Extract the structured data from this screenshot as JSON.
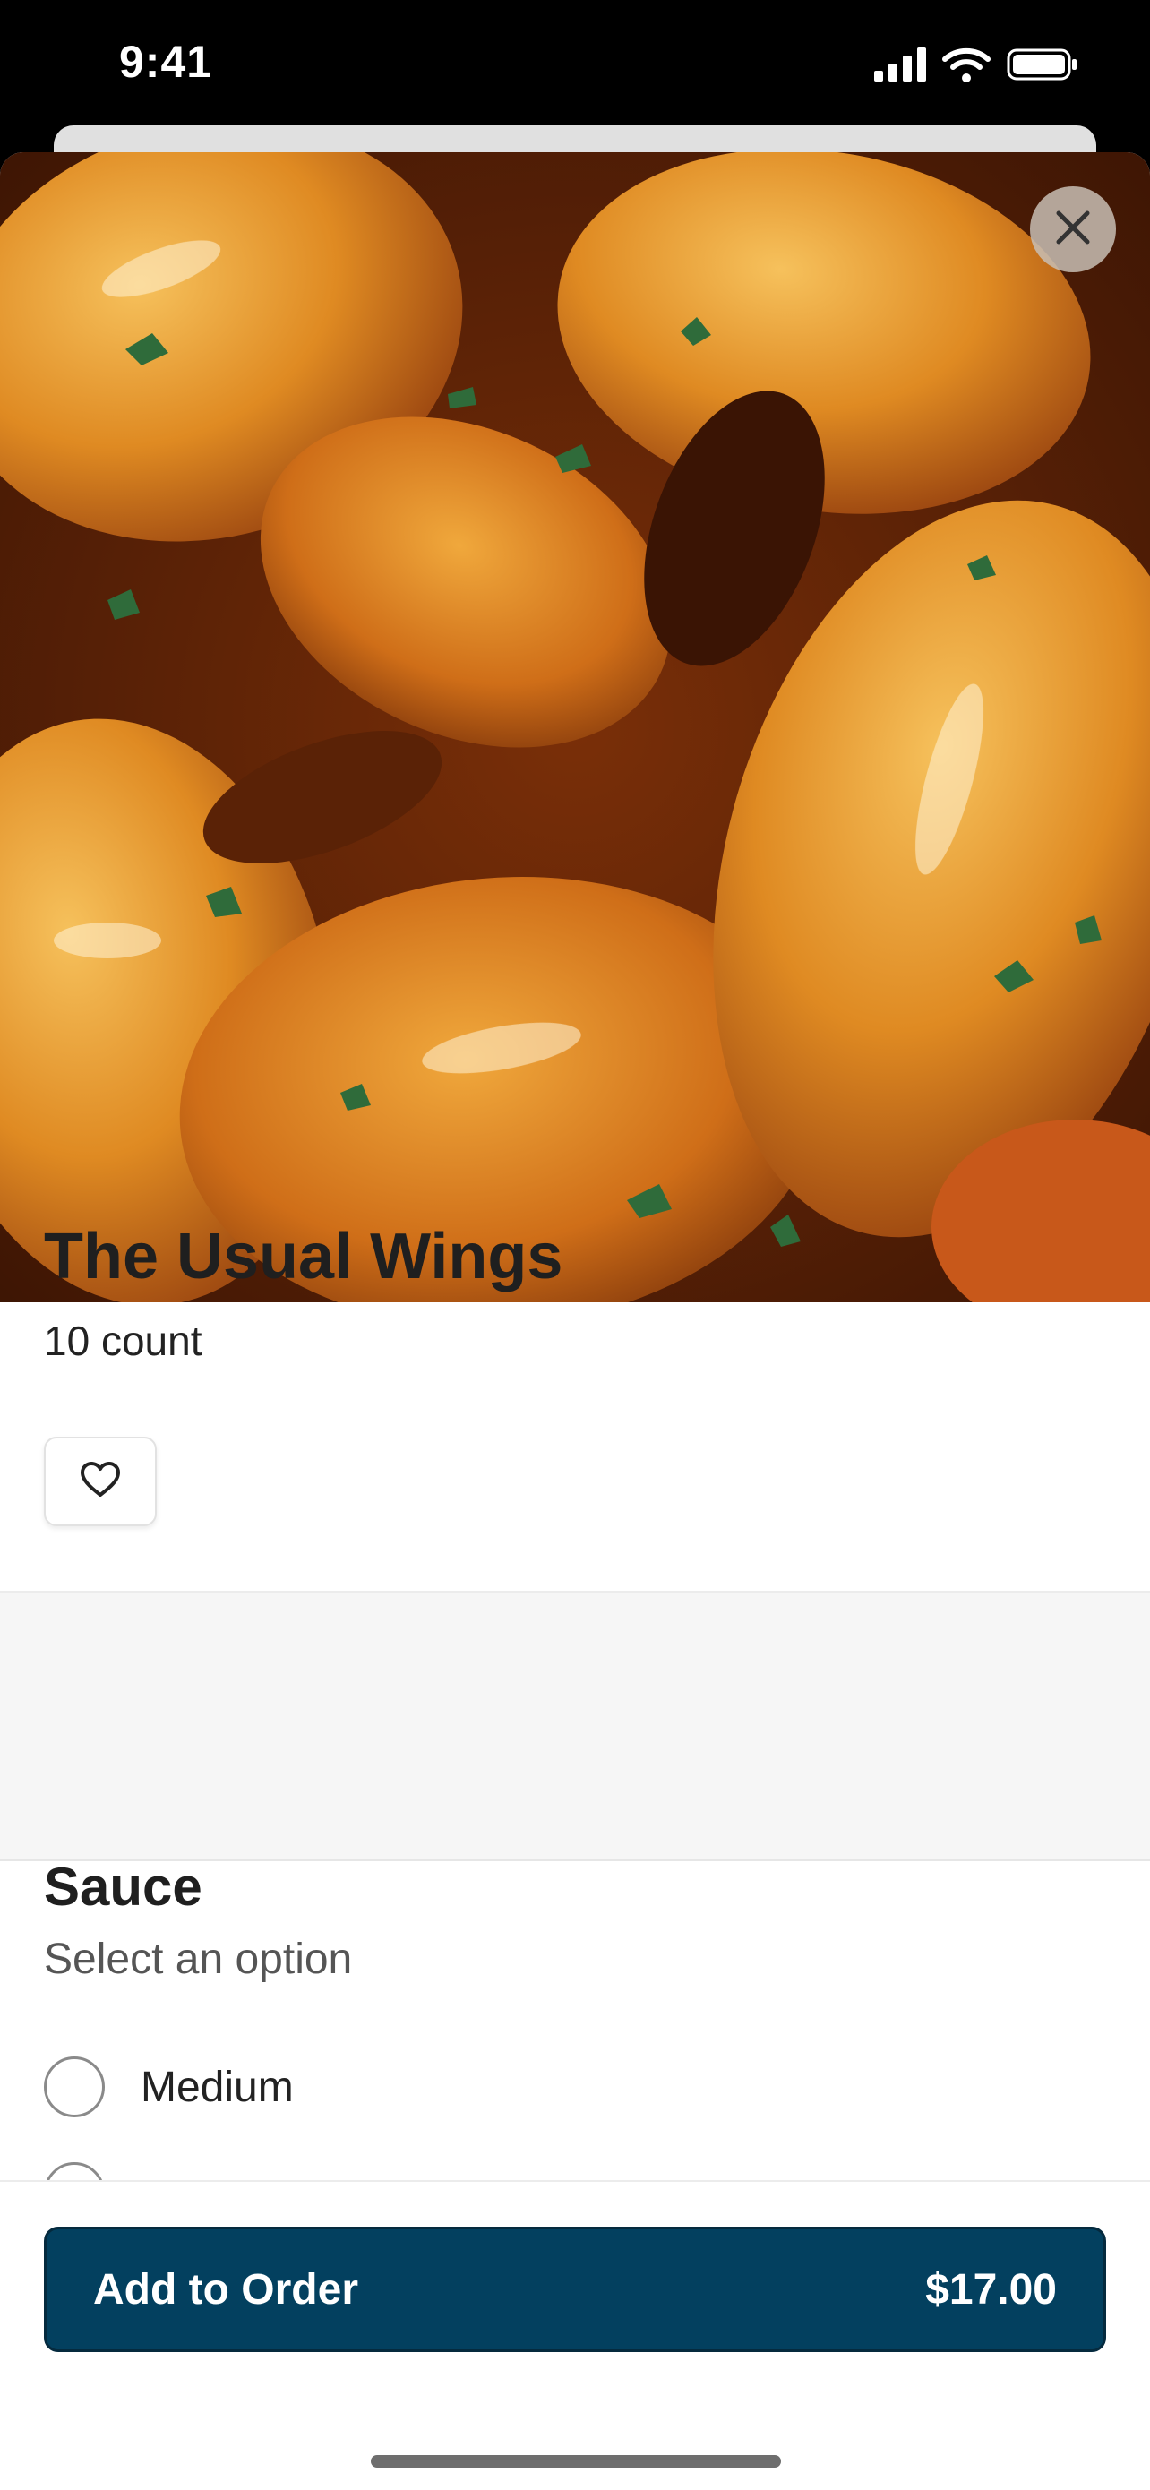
{
  "status": {
    "time": "9:41"
  },
  "item": {
    "title": "The Usual Wings",
    "subtitle": "10 count"
  },
  "modifier": {
    "title": "Sauce",
    "subtitle": "Select an option",
    "options": [
      {
        "label": "Medium",
        "selected": false
      },
      {
        "label": "",
        "selected": false
      }
    ]
  },
  "cta": {
    "label": "Add to Order",
    "price": "$17.00",
    "color": "#03405f"
  },
  "icons": {
    "close": "close-icon",
    "favorite": "heart-icon",
    "signal": "cellular-signal-icon",
    "wifi": "wifi-icon",
    "battery": "battery-icon"
  }
}
